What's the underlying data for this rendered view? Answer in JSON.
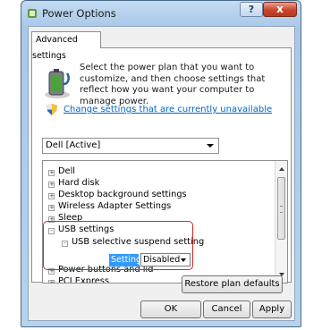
{
  "window": {
    "title": "Power Options",
    "help_label": "?",
    "close_label": "x"
  },
  "tab": {
    "label": "Advanced settings"
  },
  "description": "Select the power plan that you want to customize, and then choose settings that reflect how you want your computer to manage power.",
  "change_settings_link": "Change settings that are currently unavailable",
  "plan_dropdown": {
    "selected": "Dell [Active]"
  },
  "tree": {
    "items": [
      {
        "label": "Dell",
        "expander": "+"
      },
      {
        "label": "Hard disk",
        "expander": "+"
      },
      {
        "label": "Desktop background settings",
        "expander": "+"
      },
      {
        "label": "Wireless Adapter Settings",
        "expander": "+"
      },
      {
        "label": "Sleep",
        "expander": "+"
      },
      {
        "label": "USB settings",
        "expander": "-"
      },
      {
        "label": "USB selective suspend setting",
        "expander": "-"
      },
      {
        "label": "Power buttons and lid",
        "expander": "+"
      },
      {
        "label": "PCI Express",
        "expander": "+"
      }
    ],
    "setting_label": "Setting:",
    "setting_value": "Disabled"
  },
  "buttons": {
    "restore": "Restore plan defaults",
    "ok": "OK",
    "cancel": "Cancel",
    "apply": "Apply"
  },
  "colors": {
    "link": "#0066cc",
    "selection": "#3399ff",
    "highlight_box": "#d42929"
  },
  "icons": [
    "power-options-icon",
    "battery-plug-icon",
    "uac-shield-icon",
    "dropdown-arrow-icon"
  ]
}
